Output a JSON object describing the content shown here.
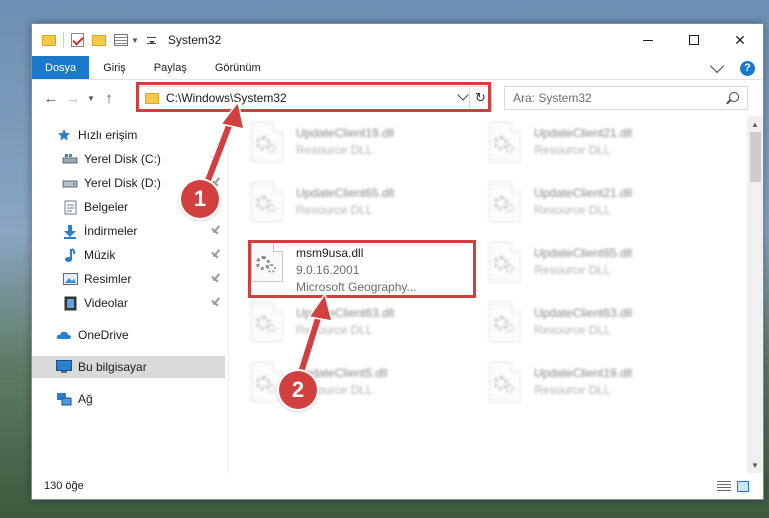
{
  "window": {
    "title": "System32"
  },
  "ribbon": {
    "tabs": [
      {
        "label": "Dosya",
        "active": true
      },
      {
        "label": "Giriş",
        "active": false
      },
      {
        "label": "Paylaş",
        "active": false
      },
      {
        "label": "Görünüm",
        "active": false
      }
    ],
    "help": "?"
  },
  "nav": {
    "address": "C:\\Windows\\System32",
    "search_placeholder": "Ara: System32"
  },
  "sidebar": {
    "items": [
      {
        "label": "Hızlı erişim",
        "icon": "star-icon",
        "pinned": false
      },
      {
        "label": "Yerel Disk (C:)",
        "icon": "drive-icon",
        "pinned": true
      },
      {
        "label": "Yerel Disk (D:)",
        "icon": "drive-icon",
        "pinned": true
      },
      {
        "label": "Belgeler",
        "icon": "documents-icon",
        "pinned": true
      },
      {
        "label": "İndirmeler",
        "icon": "download-icon",
        "pinned": true
      },
      {
        "label": "Müzik",
        "icon": "music-icon",
        "pinned": true
      },
      {
        "label": "Resimler",
        "icon": "pictures-icon",
        "pinned": true
      },
      {
        "label": "Videolar",
        "icon": "videos-icon",
        "pinned": true
      },
      {
        "label": "OneDrive",
        "icon": "cloud-icon",
        "pinned": false
      },
      {
        "label": "Bu bilgisayar",
        "icon": "computer-icon",
        "pinned": false,
        "selected": true
      },
      {
        "label": "Ağ",
        "icon": "network-icon",
        "pinned": false
      }
    ]
  },
  "files": {
    "left": [
      {
        "name": "UpdateClient19.dll",
        "line2": "Resource DLL",
        "line3": ""
      },
      {
        "name": "UpdateClient65.dll",
        "line2": "Resource DLL",
        "line3": ""
      },
      {
        "name": "msm9usa.dll",
        "line2": "9.0.16.2001",
        "line3": "Microsoft Geography..."
      },
      {
        "name": "UpdateClient63.dll",
        "line2": "Resource DLL",
        "line3": ""
      },
      {
        "name": "UpdateClient5.dll",
        "line2": "Resource DLL",
        "line3": ""
      }
    ],
    "right": [
      {
        "name": "UpdateClient21.dll",
        "line2": "Resource DLL"
      },
      {
        "name": "UpdateClient21.dll",
        "line2": "Resource DLL"
      },
      {
        "name": "UpdateClient65.dll",
        "line2": "Resource DLL"
      },
      {
        "name": "UpdateClient63.dll",
        "line2": "Resource DLL"
      },
      {
        "name": "UpdateClient19.dll",
        "line2": "Resource DLL"
      }
    ]
  },
  "status": {
    "count": "130 öğe"
  },
  "annotations": {
    "callout1": "1",
    "callout2": "2",
    "color": "#d23f3f"
  },
  "colors": {
    "accent": "#1979ca",
    "selection": "#d9d9d9"
  }
}
